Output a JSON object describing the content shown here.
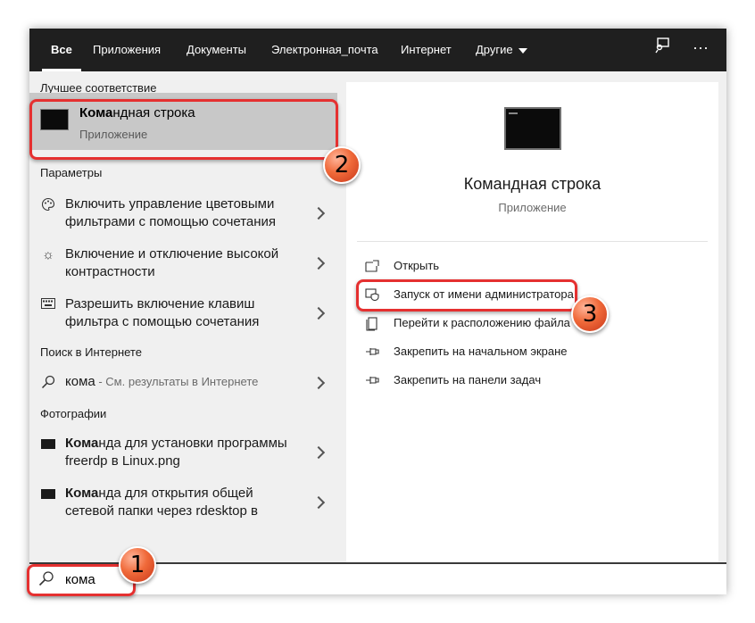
{
  "tabs": [
    {
      "label": "Все",
      "active": true
    },
    {
      "label": "Приложения"
    },
    {
      "label": "Документы"
    },
    {
      "label": "Электронная_почта"
    },
    {
      "label": "Интернет"
    },
    {
      "label": "Другие"
    }
  ],
  "toolbar": {
    "feedback_icon": "feedback-icon",
    "more_label": "···"
  },
  "left": {
    "best_match_header": "Лучшее соответствие",
    "best_match": {
      "title": "Командная строка",
      "subtitle": "Приложение"
    },
    "settings_header": "Параметры",
    "settings": [
      {
        "icon": "palette-icon",
        "line1": "Включить управление цветовыми",
        "line2": "фильтрами с помощью сочетания"
      },
      {
        "icon": "brightness-icon",
        "line1": "Включение и отключение высокой",
        "line2": "контрастности"
      },
      {
        "icon": "keyboard-icon",
        "line1": "Разрешить включение клавиш",
        "line2": "фильтра с помощью сочетания"
      }
    ],
    "web_header": "Поиск в Интернете",
    "web": {
      "query": "кома",
      "hint": " - См. результаты в Интернете"
    },
    "photos_header": "Фотографии",
    "photos": [
      {
        "line1_bold": "Кома",
        "line1_rest": "нда для установки программы",
        "line2": "freerdp в Linux.png"
      },
      {
        "line1_bold": "Кома",
        "line1_rest": "нда для открытия общей",
        "line2": "сетевой папки через rdesktop в"
      }
    ]
  },
  "right": {
    "app_name": "Командная строка",
    "app_type": "Приложение",
    "actions": [
      {
        "icon": "open-icon",
        "label": "Открыть"
      },
      {
        "icon": "shield-icon",
        "label": "Запуск от имени администратора"
      },
      {
        "icon": "folder-icon",
        "label": "Перейти к расположению файла"
      },
      {
        "icon": "pin-icon",
        "label": "Закрепить на начальном экране"
      },
      {
        "icon": "pin-icon",
        "label": "Закрепить на панели задач"
      }
    ]
  },
  "search": {
    "value": "кома"
  },
  "annotations": {
    "badge1": "1",
    "badge2": "2",
    "badge3": "3",
    "color": "#e53030"
  }
}
